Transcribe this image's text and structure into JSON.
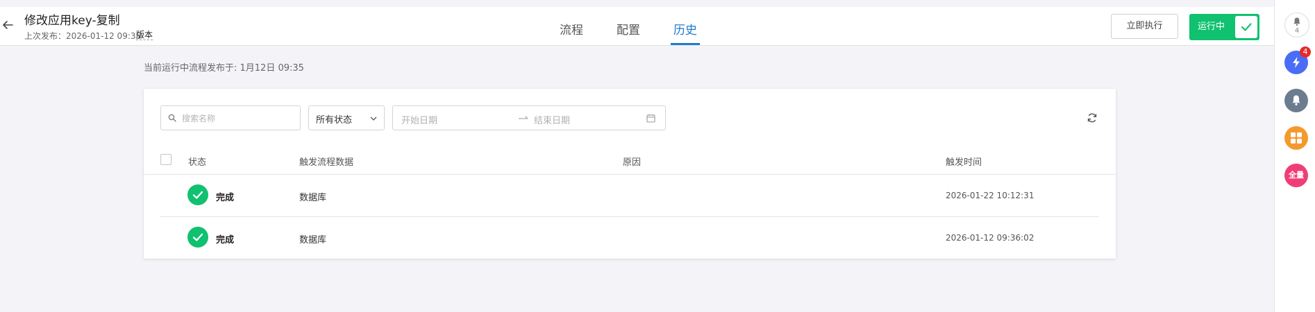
{
  "header": {
    "title": "修改应用key-复制",
    "last_published": "上次发布：2026-01-12 09:35",
    "version_link": "版本",
    "tabs": [
      {
        "label": "流程",
        "active": false
      },
      {
        "label": "配置",
        "active": false
      },
      {
        "label": "历史",
        "active": true
      }
    ],
    "execute_button": "立即执行",
    "running_button": "运行中",
    "accent_color": "#1e7bd0",
    "success_color": "#10c170"
  },
  "sidebar": {
    "notification_count": "4",
    "flash_badge": "4",
    "full_label": "全量",
    "icons": [
      "bell-icon",
      "flash-icon",
      "bell-icon",
      "grid-icon",
      "full-icon"
    ],
    "colors": [
      "#ffffff",
      "#4a6cf7",
      "#6b7c8f",
      "#f39a2e",
      "#ef3e76"
    ]
  },
  "main": {
    "publish_info": "当前运行中流程发布于: 1月12日 09:35",
    "filters": {
      "search_placeholder": "搜索名称",
      "status_value": "所有状态",
      "start_date_placeholder": "开始日期",
      "end_date_placeholder": "结束日期"
    },
    "table": {
      "columns": [
        "状态",
        "触发流程数据",
        "原因",
        "触发时间"
      ],
      "rows": [
        {
          "status": "完成",
          "data": "数据库",
          "reason": "",
          "time": "2026-01-22 10:12:31"
        },
        {
          "status": "完成",
          "data": "数据库",
          "reason": "",
          "time": "2026-01-12 09:36:02"
        }
      ]
    }
  }
}
